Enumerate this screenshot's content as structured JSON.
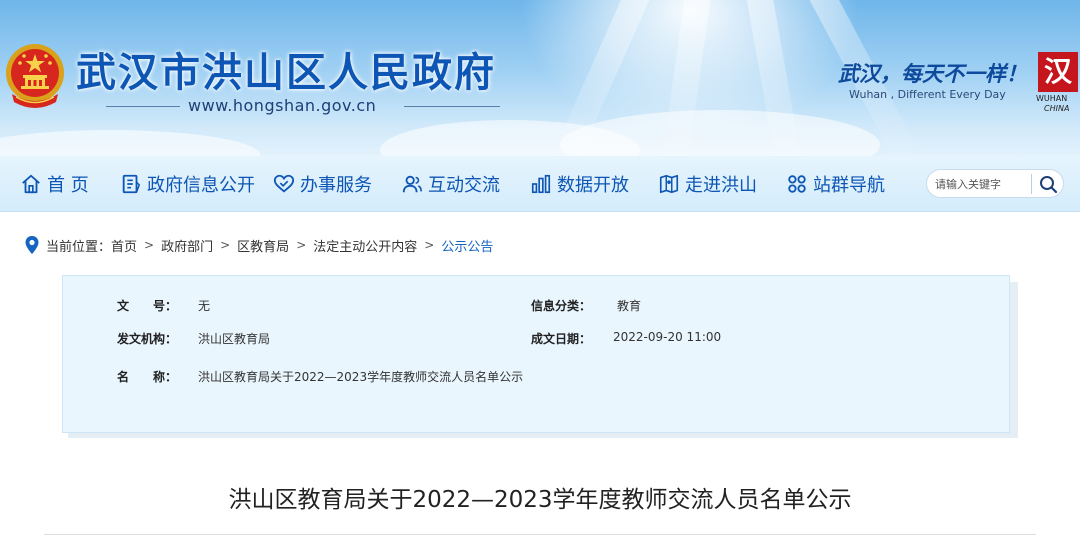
{
  "header": {
    "site_title": "武汉市洪山区人民政府",
    "site_url": "www.hongshan.gov.cn",
    "slogan_cn": "武汉，每天不一样！",
    "slogan_en": "Wuhan , Different Every Day",
    "logo_text": "WUHAN",
    "logo_subtext": "CHINA"
  },
  "nav": {
    "items": [
      {
        "label": "首 页",
        "icon": "home-icon"
      },
      {
        "label": "政府信息公开",
        "icon": "document-icon"
      },
      {
        "label": "办事服务",
        "icon": "handshake-icon"
      },
      {
        "label": "互动交流",
        "icon": "users-icon"
      },
      {
        "label": "数据开放",
        "icon": "bar-chart-icon"
      },
      {
        "label": "走进洪山",
        "icon": "map-icon"
      },
      {
        "label": "站群导航",
        "icon": "grid-icon"
      }
    ],
    "search": {
      "placeholder": "请输入关键字"
    }
  },
  "breadcrumb": {
    "prefix": "当前位置：",
    "items": [
      "首页",
      "政府部门",
      "区教育局",
      "法定主动公开内容",
      "公示公告"
    ]
  },
  "info": {
    "doc_no_label": "文　　号：",
    "doc_no_value": "无",
    "category_label": "信息分类：",
    "category_value": "教育",
    "issuer_label": "发文机构：",
    "issuer_value": "洪山区教育局",
    "date_label": "成文日期：",
    "date_value": "2022-09-20 11:00",
    "name_label": "名　　称：",
    "name_value": "洪山区教育局关于2022—2023学年度教师交流人员名单公示"
  },
  "article": {
    "title": "洪山区教育局关于2022—2023学年度教师交流人员名单公示"
  },
  "colors": {
    "brand_blue": "#0e56b5",
    "link_blue": "#1565c0",
    "panel_bg": "#e9f6fe",
    "logo_red": "#c4161c"
  }
}
